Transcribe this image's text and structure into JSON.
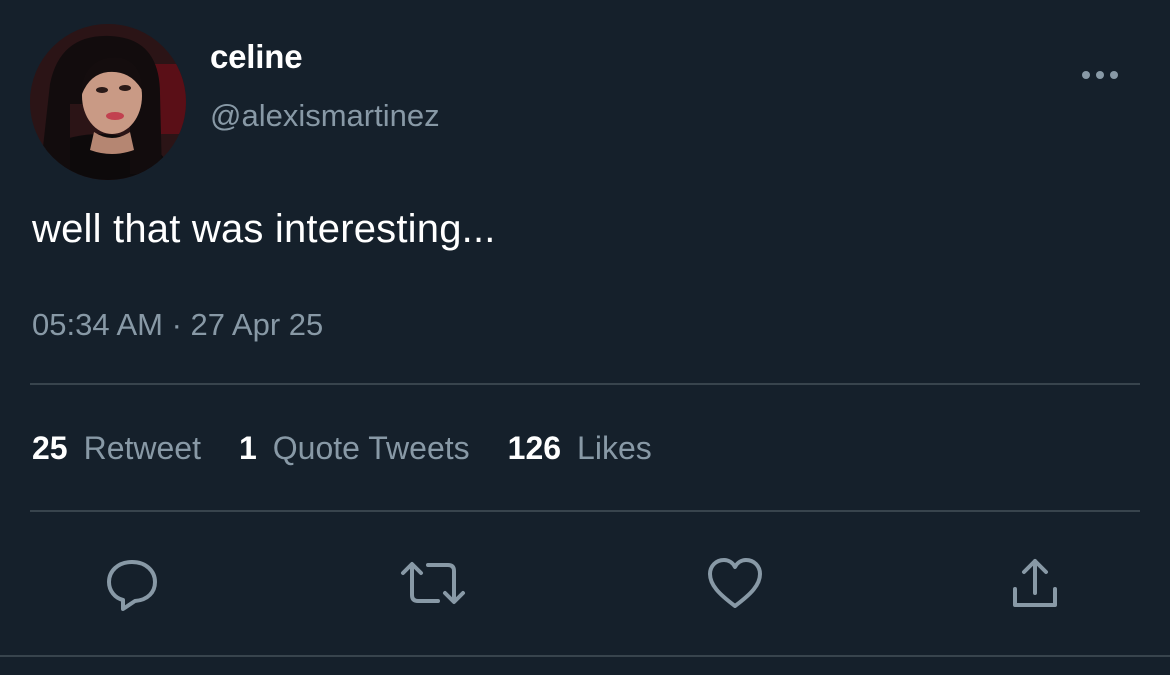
{
  "user": {
    "display_name": "celine",
    "handle": "@alexismartinez",
    "avatar": "profile-photo"
  },
  "tweet": {
    "text": "well that was interesting...",
    "timestamp": "05:34 AM · 27 Apr 25"
  },
  "stats": [
    {
      "count": "25",
      "label": "Retweet"
    },
    {
      "count": "1",
      "label": "Quote Tweets"
    },
    {
      "count": "126",
      "label": "Likes"
    }
  ],
  "actions": {
    "reply": "reply-icon",
    "retweet": "retweet-icon",
    "like": "heart-icon",
    "share": "share-icon",
    "more": "more-icon"
  },
  "colors": {
    "background": "#15202b",
    "primary_text": "#ffffff",
    "secondary_text": "#8899a6",
    "divider": "#38444d"
  }
}
